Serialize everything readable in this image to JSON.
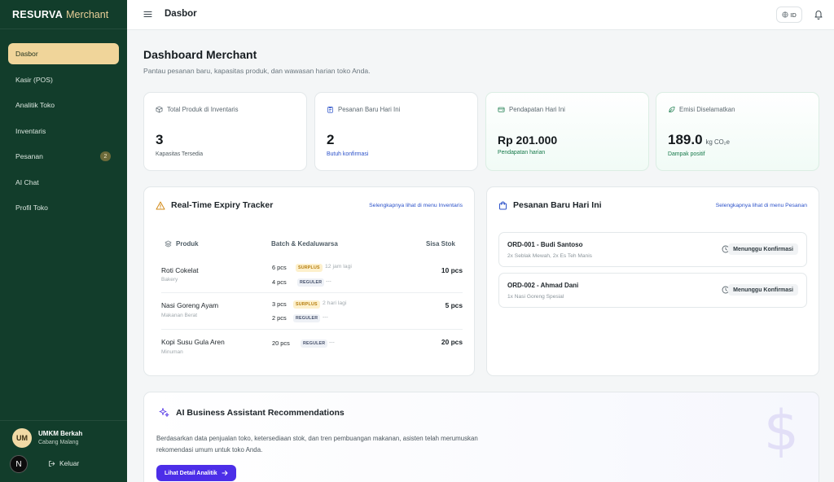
{
  "brand": {
    "name": "RESURVA",
    "accent": "Merchant"
  },
  "sidebar": {
    "items": [
      {
        "label": "Dasbor",
        "active": true
      },
      {
        "label": "Kasir (POS)"
      },
      {
        "label": "Analitik Toko"
      },
      {
        "label": "Inventaris"
      },
      {
        "label": "Pesanan",
        "badge": "2"
      },
      {
        "label": "AI Chat"
      },
      {
        "label": "Profil Toko"
      }
    ],
    "user": {
      "initials": "UM",
      "name": "UMKM Berkah",
      "branch": "Cabang Malang"
    },
    "n_badge": "N",
    "logout_label": "Keluar"
  },
  "topbar": {
    "title": "Dasbor",
    "lang": "ID"
  },
  "header": {
    "title": "Dashboard Merchant",
    "subtitle": "Pantau pesanan baru, kapasitas produk, dan wawasan harian toko Anda."
  },
  "stats": [
    {
      "label": "Total Produk di Inventaris",
      "value": "3",
      "sub": "Kapasitas Tersedia",
      "icon": "box-icon"
    },
    {
      "label": "Pesanan Baru Hari Ini",
      "value": "2",
      "sub": "Butuh konfirmasi",
      "icon": "clipboard-icon"
    },
    {
      "label": "Pendapatan Hari Ini",
      "value": "Rp 201.000",
      "sub": "Pendapatan harian",
      "icon": "wallet-icon"
    },
    {
      "label": "Emisi Diselamatkan",
      "value": "189.0",
      "unit": "kg CO₂e",
      "sub": "Dampak positif",
      "icon": "leaf-icon"
    }
  ],
  "expiry": {
    "title": "Real-Time Expiry Tracker",
    "link": "Selengkapnya lihat di menu Inventaris",
    "columns": {
      "product": "Produk",
      "batch": "Batch & Kedaluwarsa",
      "stock": "Sisa Stok"
    },
    "rows": [
      {
        "name": "Roti Cokelat",
        "category": "Bakery",
        "b1_qty": "6 pcs",
        "b1_tag": "SURPLUS",
        "b1_note": "12 jam lagi",
        "b2_qty": "4 pcs",
        "b2_tag": "REGULER",
        "b2_note": "---",
        "stock": "10 pcs"
      },
      {
        "name": "Nasi Goreng Ayam",
        "category": "Makanan Berat",
        "b1_qty": "3 pcs",
        "b1_tag": "SURPLUS",
        "b1_note": "2 hari lagi",
        "b2_qty": "2 pcs",
        "b2_tag": "REGULER",
        "b2_note": "---",
        "stock": "5 pcs"
      },
      {
        "name": "Kopi Susu Gula Aren",
        "category": "Minuman",
        "b1_qty": "20 pcs",
        "b1_tag": "REGULER",
        "b1_note": "---",
        "stock": "20 pcs"
      }
    ]
  },
  "orders": {
    "title": "Pesanan Baru Hari Ini",
    "link": "Selengkapnya lihat di menu Pesanan",
    "items": [
      {
        "title": "ORD-001 - Budi Santoso",
        "desc": "2x Seblak Mewah, 2x Es Teh Manis",
        "status": "Menunggu Konfirmasi"
      },
      {
        "title": "ORD-002 - Ahmad Dani",
        "desc": "1x Nasi Goreng Spesial",
        "status": "Menunggu Konfirmasi"
      }
    ]
  },
  "ai": {
    "title": "AI Business Assistant Recommendations",
    "text": "Berdasarkan data penjualan toko, ketersediaan stok, dan tren pembuangan makanan, asisten telah merumuskan rekomendasi umum untuk toko Anda.",
    "button": "Lihat Detail Analitik",
    "decor": "$"
  },
  "colors": {
    "sidebar_bg": "#123d2b",
    "active_nav": "#f0d59a",
    "link_blue": "#2c52c9",
    "green_text": "#177a4a",
    "ai_button": "#4c2ee8"
  }
}
